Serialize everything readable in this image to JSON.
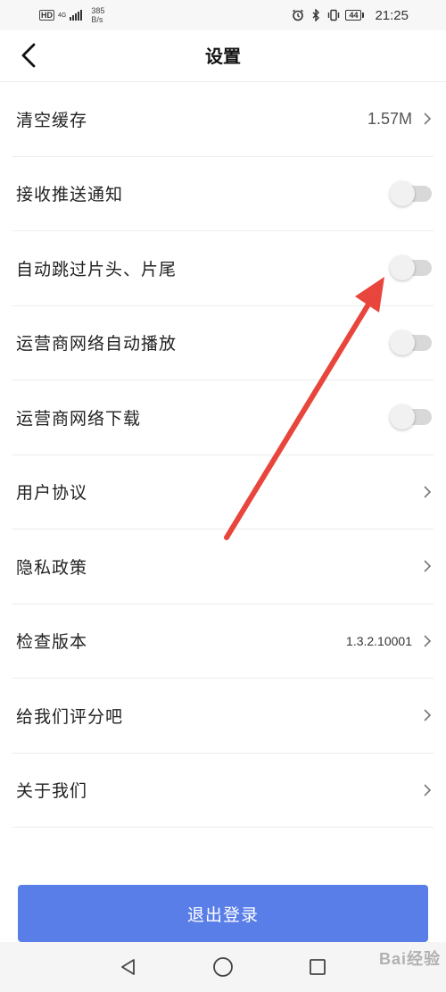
{
  "status_bar": {
    "hd": "HD",
    "network": "4G",
    "speed_value": "385",
    "speed_unit": "B/s",
    "battery": "44",
    "time": "21:25",
    "icons": [
      "alarm-icon",
      "bluetooth-icon",
      "vibrate-icon",
      "battery-icon"
    ]
  },
  "header": {
    "title": "设置",
    "back_icon": "back-arrow-icon"
  },
  "settings": {
    "items": [
      {
        "label": "清空缓存",
        "value": "1.57M",
        "type": "value-chevron"
      },
      {
        "label": "接收推送通知",
        "type": "toggle",
        "on": false
      },
      {
        "label": "自动跳过片头、片尾",
        "type": "toggle",
        "on": false
      },
      {
        "label": "运营商网络自动播放",
        "type": "toggle",
        "on": false
      },
      {
        "label": "运营商网络下载",
        "type": "toggle",
        "on": false
      },
      {
        "label": "用户协议",
        "type": "chevron"
      },
      {
        "label": "隐私政策",
        "type": "chevron"
      },
      {
        "label": "检查版本",
        "value": "1.3.2.10001",
        "type": "value-chevron"
      },
      {
        "label": "给我们评分吧",
        "type": "chevron"
      },
      {
        "label": "关于我们",
        "type": "chevron"
      }
    ]
  },
  "logout": {
    "label": "退出登录"
  },
  "nav": {
    "icons": [
      "back-triangle-icon",
      "home-circle-icon",
      "recents-square-icon"
    ]
  },
  "watermark": {
    "text": "Bai经验"
  },
  "colors": {
    "accent": "#5a7ee8",
    "annotation_arrow": "#e8453c",
    "toggle_off_track": "#d8d8d8"
  }
}
